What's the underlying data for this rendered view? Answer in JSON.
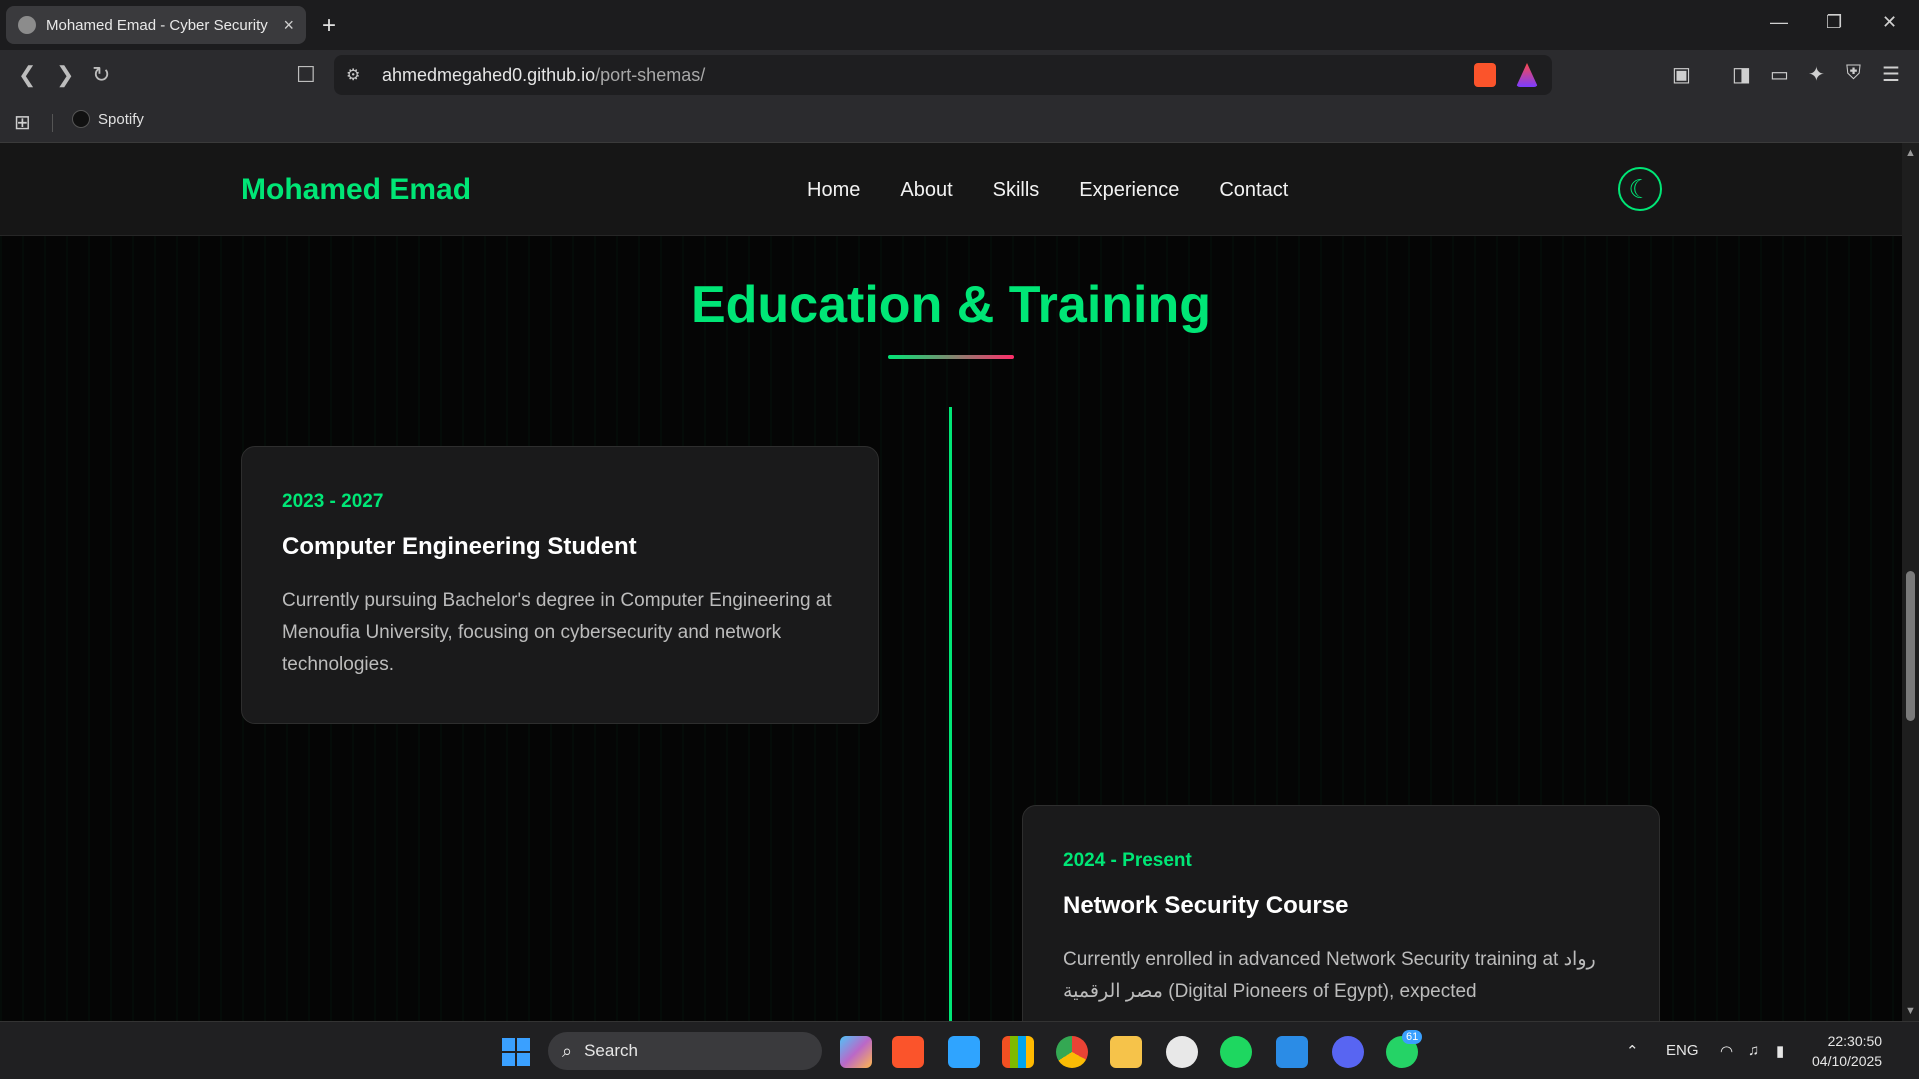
{
  "browser": {
    "tab_title": "Mohamed Emad - Cyber Security",
    "tab_close": "×",
    "new_tab": "+",
    "window_controls": {
      "minimize": "—",
      "maximize": "❐",
      "close": "✕"
    },
    "url": {
      "host": "ahmedmegahed0.github.io",
      "path": "/port-shemas/"
    },
    "bookmarks": [
      {
        "label": "Spotify"
      }
    ]
  },
  "site": {
    "brand": "Mohamed Emad",
    "nav": [
      "Home",
      "About",
      "Skills",
      "Experience",
      "Contact"
    ],
    "theme_toggle_icon": "☾",
    "accent": "#00e676",
    "gradient_end": "#ff2d6a"
  },
  "section": {
    "title": "Education & Training",
    "items": [
      {
        "date": "2023 - 2027",
        "title": "Computer Engineering Student",
        "description": "Currently pursuing Bachelor's degree in Computer Engineering at Menoufia University, focusing on cybersecurity and network technologies."
      },
      {
        "date": "2024 - Present",
        "title": "Network Security Course",
        "description": "Currently enrolled in advanced Network Security training at رواد مصر الرقمية (Digital Pioneers of Egypt), expected"
      }
    ]
  },
  "taskbar": {
    "search_placeholder": "Search",
    "whatsapp_badge": "61",
    "language": "ENG",
    "time": "22:30:50",
    "date": "04/10/2025"
  }
}
